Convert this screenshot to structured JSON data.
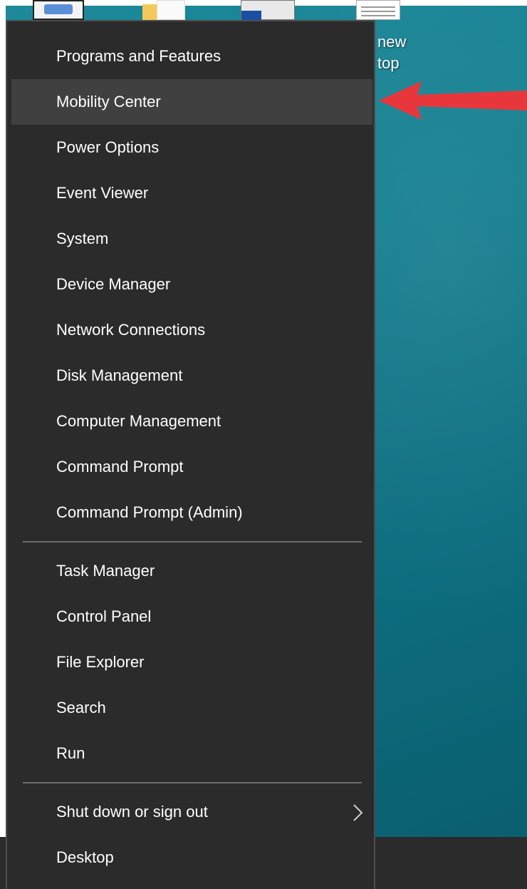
{
  "desktop": {
    "shortcut_label_line1": "new",
    "shortcut_label_line2": "top"
  },
  "menu": {
    "groups": [
      [
        {
          "label": "Programs and Features",
          "highlighted": false
        },
        {
          "label": "Mobility Center",
          "highlighted": true
        },
        {
          "label": "Power Options",
          "highlighted": false
        },
        {
          "label": "Event Viewer",
          "highlighted": false
        },
        {
          "label": "System",
          "highlighted": false
        },
        {
          "label": "Device Manager",
          "highlighted": false
        },
        {
          "label": "Network Connections",
          "highlighted": false
        },
        {
          "label": "Disk Management",
          "highlighted": false
        },
        {
          "label": "Computer Management",
          "highlighted": false
        },
        {
          "label": "Command Prompt",
          "highlighted": false
        },
        {
          "label": "Command Prompt (Admin)",
          "highlighted": false
        }
      ],
      [
        {
          "label": "Task Manager",
          "highlighted": false
        },
        {
          "label": "Control Panel",
          "highlighted": false
        },
        {
          "label": "File Explorer",
          "highlighted": false
        },
        {
          "label": "Search",
          "highlighted": false
        },
        {
          "label": "Run",
          "highlighted": false
        }
      ],
      [
        {
          "label": "Shut down or sign out",
          "highlighted": false,
          "has_submenu": true
        },
        {
          "label": "Desktop",
          "highlighted": false
        }
      ]
    ]
  },
  "annotation": {
    "arrow_color": "#e8373c",
    "points_to": "Mobility Center"
  },
  "colors": {
    "menu_bg": "#2b2b2b",
    "menu_highlight": "#404040",
    "menu_text": "#ffffff",
    "desktop_teal": "#127d8e"
  }
}
